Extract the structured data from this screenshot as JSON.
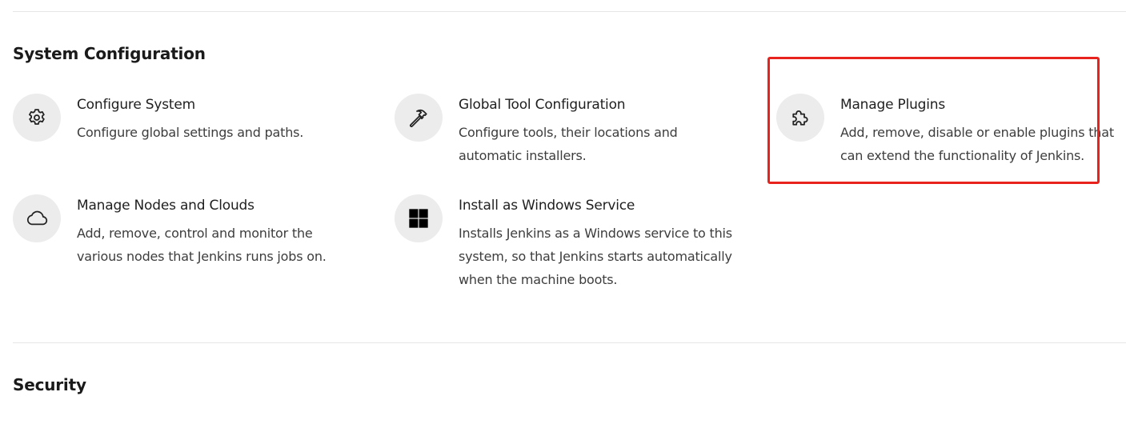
{
  "sections": [
    {
      "title": "System Configuration",
      "items": [
        {
          "icon": "gear-icon",
          "title": "Configure System",
          "description": "Configure global settings and paths."
        },
        {
          "icon": "hammer-icon",
          "title": "Global Tool Configuration",
          "description": "Configure tools, their locations and automatic installers."
        },
        {
          "icon": "puzzle-icon",
          "title": "Manage Plugins",
          "description": "Add, remove, disable or enable plugins that can extend the functionality of Jenkins."
        },
        {
          "icon": "cloud-icon",
          "title": "Manage Nodes and Clouds",
          "description": "Add, remove, control and monitor the various nodes that Jenkins runs jobs on."
        },
        {
          "icon": "windows-icon",
          "title": "Install as Windows Service",
          "description": "Installs Jenkins as a Windows service to this system, so that Jenkins starts automatically when the machine boots."
        }
      ]
    },
    {
      "title": "Security"
    }
  ],
  "highlight": {
    "color": "#e8231d",
    "target": "Manage Plugins"
  }
}
